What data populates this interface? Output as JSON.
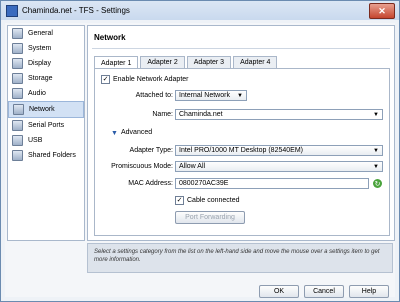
{
  "window": {
    "title": "Chaminda.net - TFS - Settings",
    "close_glyph": "✕"
  },
  "sidebar": {
    "items": [
      {
        "label": "General",
        "icon": "general-icon"
      },
      {
        "label": "System",
        "icon": "system-icon"
      },
      {
        "label": "Display",
        "icon": "display-icon"
      },
      {
        "label": "Storage",
        "icon": "storage-icon"
      },
      {
        "label": "Audio",
        "icon": "audio-icon"
      },
      {
        "label": "Network",
        "icon": "network-icon",
        "selected": true
      },
      {
        "label": "Serial Ports",
        "icon": "serial-ports-icon"
      },
      {
        "label": "USB",
        "icon": "usb-icon"
      },
      {
        "label": "Shared Folders",
        "icon": "shared-folders-icon"
      }
    ]
  },
  "main": {
    "title": "Network",
    "tabs": [
      "Adapter 1",
      "Adapter 2",
      "Adapter 3",
      "Adapter 4"
    ],
    "active_tab": "Adapter 1",
    "enable_label": "Enable Network Adapter",
    "enable_checked": true,
    "attached_label": "Attached to:",
    "attached_value": "Internal Network",
    "name_label": "Name:",
    "name_value": "Chaminda.net",
    "advanced_label": "Advanced",
    "adapter_type_label": "Adapter Type:",
    "adapter_type_value": "Intel PRO/1000 MT Desktop (82540EM)",
    "promiscuous_label": "Promiscuous Mode:",
    "promiscuous_value": "Allow All",
    "mac_label": "MAC Address:",
    "mac_value": "0800270AC39E",
    "cable_label": "Cable connected",
    "cable_checked": true,
    "port_forwarding_label": "Port Forwarding"
  },
  "info_text": "Select a settings category from the list on the left-hand side and move the mouse over a settings item to get more information.",
  "buttons": {
    "ok": "OK",
    "cancel": "Cancel",
    "help": "Help"
  },
  "glyphs": {
    "check": "✓",
    "dropdown": "▼",
    "expander": "▼",
    "refresh": "↻"
  }
}
